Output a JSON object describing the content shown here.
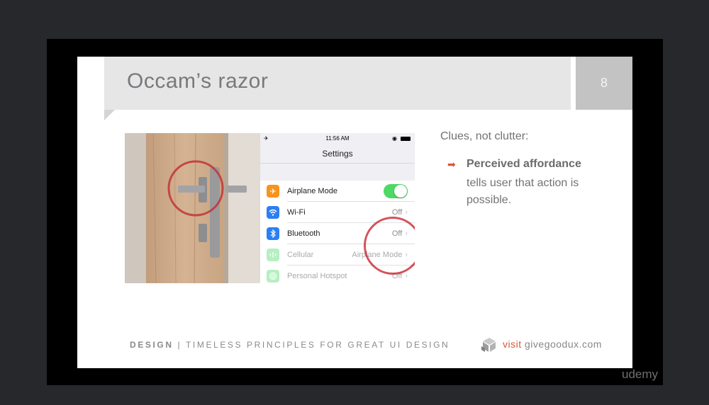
{
  "slide": {
    "title": "Occam’s razor",
    "page_number": "8",
    "heading": "Clues, not clutter:",
    "bullet_icon": "arrow-right-icon",
    "bullet_title": "Perceived affordance",
    "bullet_body": "tells user that action is possible.",
    "footer_bold": "DESIGN",
    "footer_rest": " | TIMELESS PRINCIPLES FOR GREAT UI DESIGN",
    "visit_word": "visit",
    "visit_site": "givegoodux.com",
    "accent_color": "#d55a36"
  },
  "phone": {
    "time": "11:56 AM",
    "nav_title": "Settings",
    "rows": [
      {
        "label": "Airplane Mode",
        "value": "",
        "icon": "airplane-icon",
        "color": "#f7931e",
        "toggle_on": true
      },
      {
        "label": "Wi-Fi",
        "value": "Off",
        "icon": "wifi-icon",
        "color": "#2b7ff5"
      },
      {
        "label": "Bluetooth",
        "value": "Off",
        "icon": "bluetooth-icon",
        "color": "#2b7ff5"
      },
      {
        "label": "Cellular",
        "value": "Airplane Mode",
        "icon": "cellular-icon",
        "color": "#4cd964"
      },
      {
        "label": "Personal Hotspot",
        "value": "Off",
        "icon": "hotspot-icon",
        "color": "#4cd964"
      }
    ]
  },
  "player": {
    "watermark": "udemy"
  }
}
